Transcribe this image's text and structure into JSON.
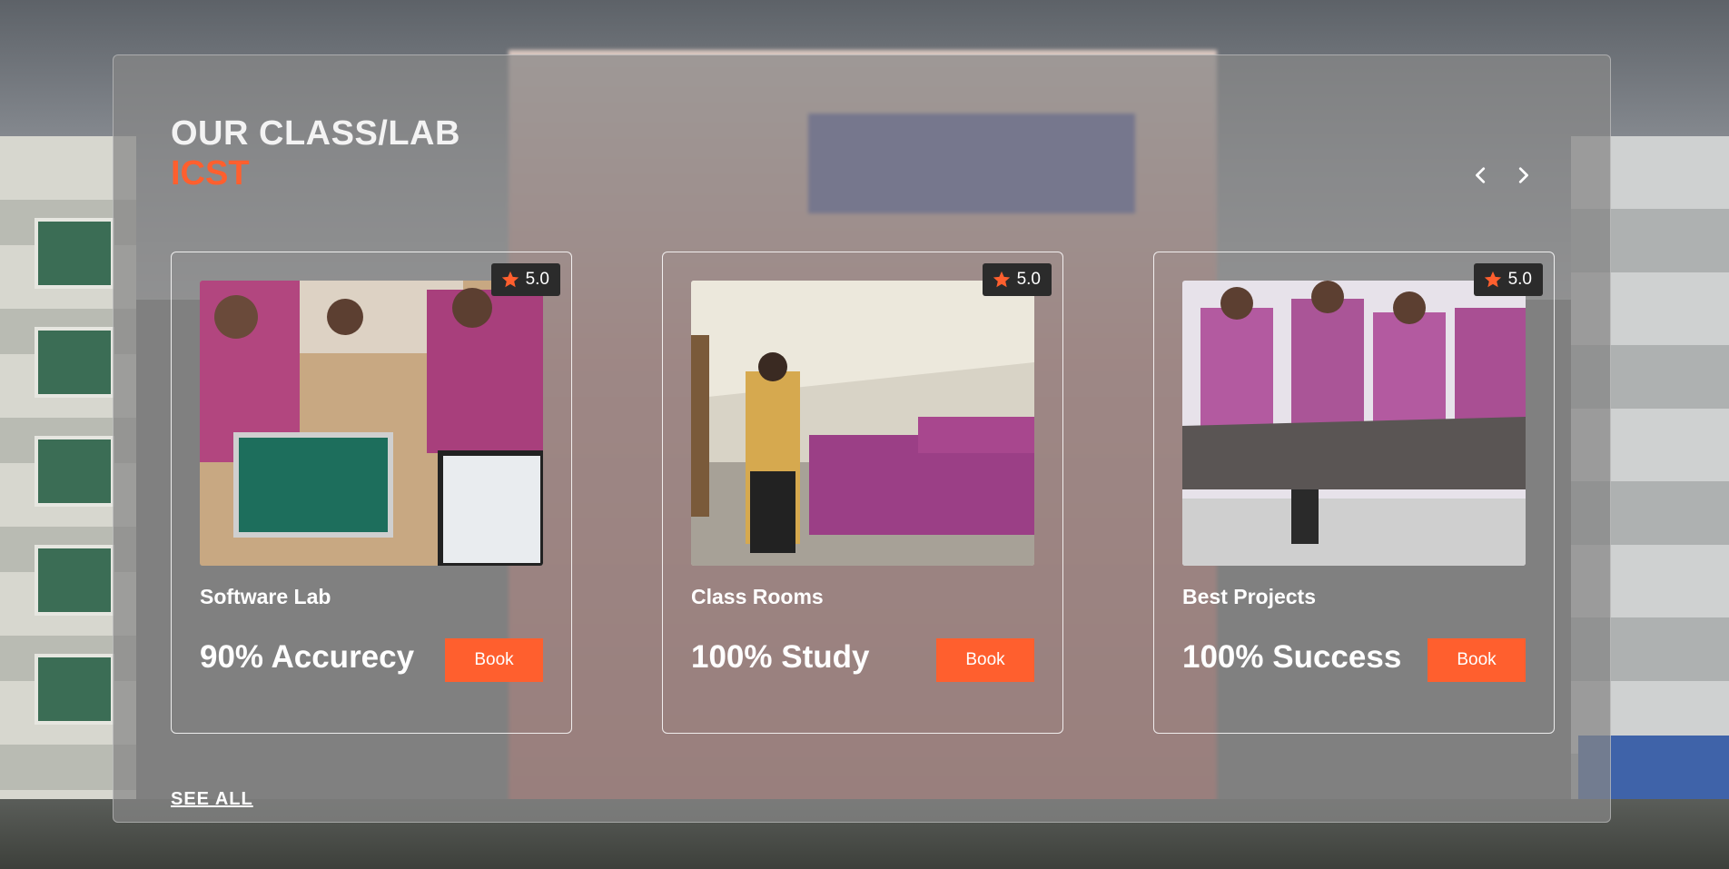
{
  "header": {
    "title": "OUR CLASS/LAB",
    "subtitle": "ICST"
  },
  "nav": {
    "prev_icon": "chevron-left-icon",
    "next_icon": "chevron-right-icon"
  },
  "cards": [
    {
      "name": "Software Lab",
      "rating": "5.0",
      "stat": "90% Accurecy",
      "button": "Book",
      "rating_icon": "star-icon"
    },
    {
      "name": "Class Rooms",
      "rating": "5.0",
      "stat": "100% Study",
      "button": "Book",
      "rating_icon": "star-icon"
    },
    {
      "name": "Best Projects",
      "rating": "5.0",
      "stat": "100% Success",
      "button": "Book",
      "rating_icon": "star-icon"
    }
  ],
  "footer": {
    "see_all": "SEE ALL"
  },
  "colors": {
    "accent": "#ff5f2e",
    "badge_bg": "#2b2b2b",
    "text": "#ffffff"
  }
}
